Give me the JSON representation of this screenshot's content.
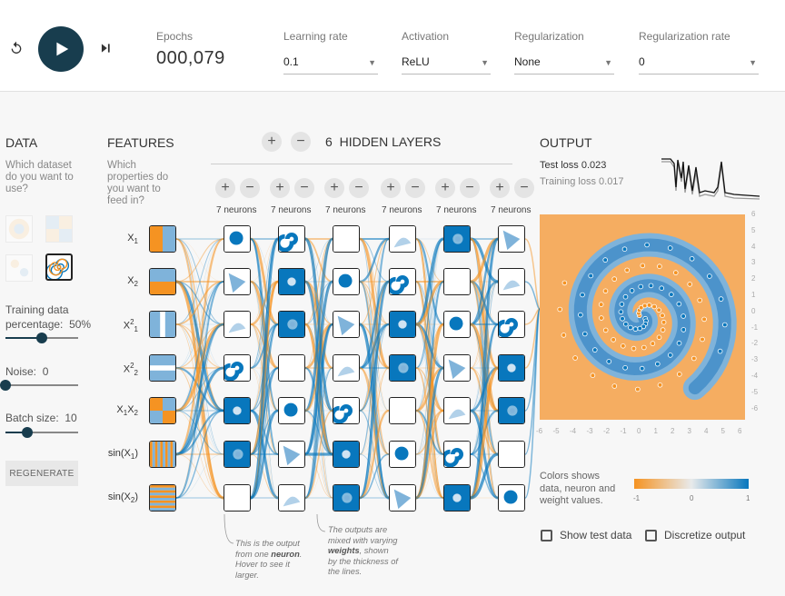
{
  "top": {
    "epochs_label": "Epochs",
    "epochs_value": "000,079",
    "learning_rate": {
      "label": "Learning rate",
      "value": "0.1"
    },
    "activation": {
      "label": "Activation",
      "value": "ReLU"
    },
    "regularization": {
      "label": "Regularization",
      "value": "None"
    },
    "regularization_rate": {
      "label": "Regularization rate",
      "value": "0"
    }
  },
  "data": {
    "title": "DATA",
    "hint": [
      "Which dataset",
      "do you want to",
      "use?"
    ],
    "training_label": [
      "Training data",
      "percentage:"
    ],
    "training_value": "50%",
    "training_fraction": 0.5,
    "noise_label": "Noise:",
    "noise_value": "0",
    "noise_fraction": 0.0,
    "batch_label": "Batch size:",
    "batch_value": "10",
    "batch_fraction": 0.3,
    "regenerate": "REGENERATE"
  },
  "features": {
    "title": "FEATURES",
    "hint": [
      "Which",
      "properties do",
      "you want to",
      "feed in?"
    ],
    "items": [
      {
        "base": "X",
        "sub": "1",
        "sup": ""
      },
      {
        "base": "X",
        "sub": "2",
        "sup": ""
      },
      {
        "base": "X",
        "sub": "1",
        "sup": "2"
      },
      {
        "base": "X",
        "sub": "2",
        "sup": "2"
      },
      {
        "base": "X",
        "sub": "1",
        "sup": "",
        "base2": "X",
        "sub2": "2"
      },
      {
        "base": "sin(X",
        "sub": "1",
        "sup": "",
        "tail": ")"
      },
      {
        "base": "sin(X",
        "sub": "2",
        "sup": "",
        "tail": ")"
      }
    ]
  },
  "hidden": {
    "count": "6",
    "label": "HIDDEN LAYERS",
    "plus": "+",
    "minus": "−",
    "neurons_label": "7 neurons"
  },
  "callouts": {
    "c1_line1": "This is the output",
    "c1_line2a": "from one ",
    "c1_bold": "neuron",
    "c1_line2b": ".",
    "c1_line3": "Hover to see it",
    "c1_line4": "larger.",
    "c2_line1": "The outputs are",
    "c2_line2": "mixed with varying",
    "c2_bold": "weights",
    "c2_line3b": ", shown",
    "c2_line4": "by the thickness of",
    "c2_line5": "the lines."
  },
  "output": {
    "title": "OUTPUT",
    "test_loss_label": "Test loss",
    "test_loss_value": "0.023",
    "train_loss_label": "Training loss",
    "train_loss_value": "0.017",
    "axis_ticks": [
      "6",
      "5",
      "4",
      "3",
      "2",
      "1",
      "0",
      "-1",
      "-2",
      "-3",
      "-4",
      "-5",
      "-6"
    ],
    "x_ticks": [
      "-6",
      "-5",
      "-4",
      "-3",
      "-2",
      "-1",
      "0",
      "1",
      "2",
      "3",
      "4",
      "5",
      "6"
    ],
    "legend_lines": [
      "Colors shows",
      "data, neuron and",
      "weight values."
    ],
    "legend_min": "-1",
    "legend_mid": "0",
    "legend_max": "1",
    "show_test": "Show test data",
    "discretize": "Discretize output"
  },
  "colors": {
    "orange": "#f59322",
    "blue": "#0877bd",
    "dark": "#183d4e"
  }
}
